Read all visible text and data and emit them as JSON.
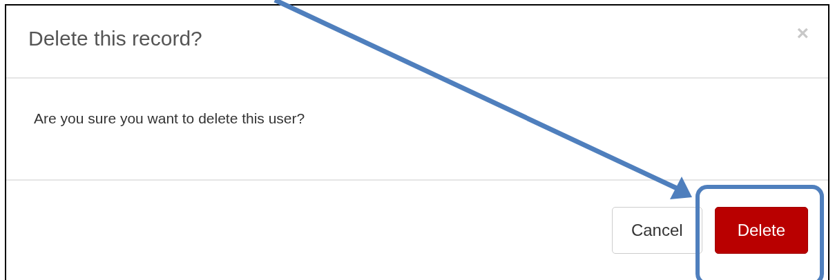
{
  "dialog": {
    "title": "Delete this record?",
    "close": "×",
    "message": "Are you sure you want to delete this user?",
    "buttons": [
      {
        "kind": "default",
        "label": "Cancel"
      },
      {
        "kind": "danger",
        "label": "Delete"
      }
    ]
  }
}
